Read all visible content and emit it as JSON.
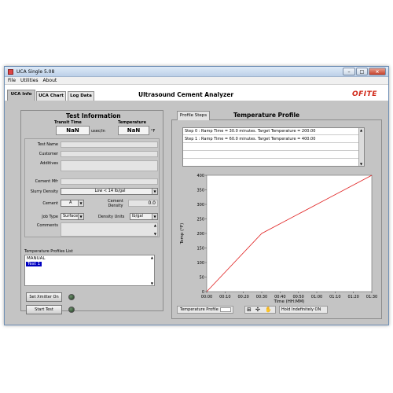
{
  "window": {
    "title": "UCA Single 5.08"
  },
  "menu": [
    "File",
    "Utilities",
    "About"
  ],
  "tabs": [
    "UCA Info",
    "UCA Chart",
    "Log Data"
  ],
  "app_title": "Ultrasound Cement Analyzer",
  "logo_text": "OFITE",
  "test_info": {
    "heading": "Test Information",
    "transit_label": "Transit Time",
    "transit_value": "NaN",
    "transit_unit": "usec/in",
    "temperature_label": "Temperature",
    "temperature_value": "NaN",
    "temperature_unit": "°F"
  },
  "form": {
    "test_name": "Test Name",
    "customer": "Customer",
    "additives": "Additives",
    "cement_mfr": "Cement Mfr",
    "slurry_density_label": "Slurry Density",
    "slurry_density_value": "Low < 14 lb/gal",
    "cement_label": "Cement",
    "cement_value": "A",
    "cement_density_label": "Cement Density",
    "cement_density_value": "0.0",
    "job_type_label": "Job Type",
    "job_type_value": "Surface",
    "density_units_label": "Density Units",
    "density_units_value": "lb/gal",
    "comments_label": "Comments"
  },
  "profiles": {
    "label": "Temperature Profiles List",
    "items": [
      "MANUAL",
      "Test 1"
    ],
    "selected": "Test 1"
  },
  "buttons": {
    "set_xmitter": "Set Xmitter On",
    "start_test": "Start Test"
  },
  "profile_steps": {
    "tab_label": "Profile Steps",
    "title": "Temperature Profile",
    "steps": [
      "Step 0 : Ramp Time = 30.0 minutes.  Target Temperature = 200.00",
      "Step 1 : Ramp Time = 60.0 minutes.  Target Temperature = 400.00"
    ]
  },
  "legend": {
    "plot_label": "Temperature Profile",
    "hold_label": "Hold Indefinitely ON"
  },
  "chart_data": {
    "type": "line",
    "xlabel": "Time (HH:MM)",
    "ylabel": "Temp (°F)",
    "xticks": [
      "00:00",
      "00:10",
      "00:20",
      "00:30",
      "00:40",
      "00:50",
      "01:00",
      "01:10",
      "01:20",
      "01:30"
    ],
    "yticks": [
      0,
      50,
      100,
      150,
      200,
      250,
      300,
      350,
      400
    ],
    "xlim": [
      0,
      90
    ],
    "ylim": [
      0,
      400
    ],
    "series": [
      {
        "name": "Temperature Profile",
        "color": "#e02020",
        "x": [
          0,
          30,
          90
        ],
        "y": [
          0,
          200,
          400
        ]
      }
    ]
  }
}
